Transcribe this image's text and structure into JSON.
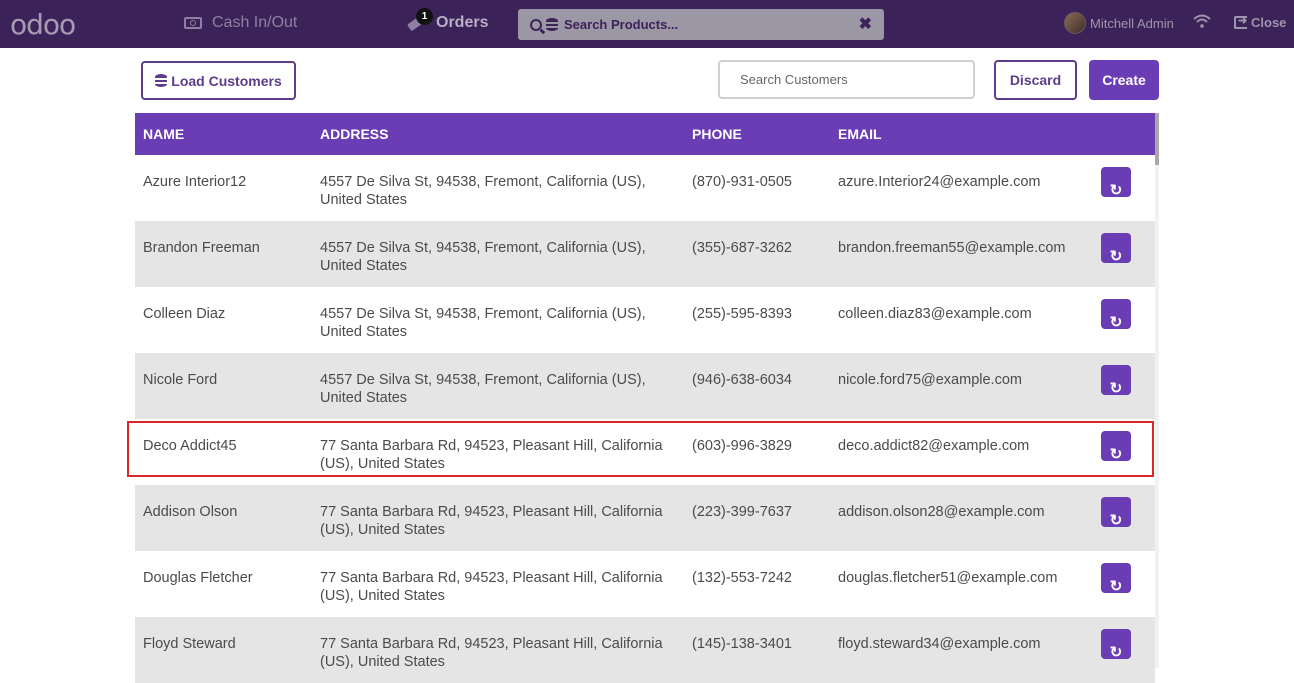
{
  "topbar": {
    "logo": "odoo",
    "cash_label": "Cash In/Out",
    "orders_label": "Orders",
    "orders_count": "1",
    "product_search_placeholder": "Search Products...",
    "clear_symbol": "✖",
    "user_name": "Mitchell Admin",
    "close_label": "Close",
    "icons": [
      "cash-icon",
      "tag-icon",
      "search-icon",
      "database-icon",
      "wifi-icon",
      "sign-out-icon"
    ]
  },
  "controls": {
    "load_customers_label": "Load Customers",
    "search_customers_placeholder": "Search Customers",
    "discard_label": "Discard",
    "create_label": "Create"
  },
  "table": {
    "headers": [
      "NAME",
      "ADDRESS",
      "PHONE",
      "EMAIL"
    ],
    "action_icon": "↻",
    "rows": [
      {
        "name": "Azure Interior12",
        "address": "4557 De Silva St, 94538, Fremont, California (US), United States",
        "phone": "(870)-931-0505",
        "email": "azure.Interior24@example.com"
      },
      {
        "name": "Brandon Freeman",
        "address": "4557 De Silva St, 94538, Fremont, California (US), United States",
        "phone": "(355)-687-3262",
        "email": "brandon.freeman55@example.com"
      },
      {
        "name": "Colleen Diaz",
        "address": "4557 De Silva St, 94538, Fremont, California (US), United States",
        "phone": "(255)-595-8393",
        "email": "colleen.diaz83@example.com"
      },
      {
        "name": "Nicole Ford",
        "address": "4557 De Silva St, 94538, Fremont, California (US), United States",
        "phone": "(946)-638-6034",
        "email": "nicole.ford75@example.com"
      },
      {
        "name": "Deco Addict45",
        "address": "77 Santa Barbara Rd, 94523, Pleasant Hill, California (US), United States",
        "phone": "(603)-996-3829",
        "email": "deco.addict82@example.com"
      },
      {
        "name": "Addison Olson",
        "address": "77 Santa Barbara Rd, 94523, Pleasant Hill, California (US), United States",
        "phone": "(223)-399-7637",
        "email": "addison.olson28@example.com"
      },
      {
        "name": "Douglas Fletcher",
        "address": "77 Santa Barbara Rd, 94523, Pleasant Hill, California (US), United States",
        "phone": "(132)-553-7242",
        "email": "douglas.fletcher51@example.com"
      },
      {
        "name": "Floyd Steward",
        "address": "77 Santa Barbara Rd, 94523, Pleasant Hill, California (US), United States",
        "phone": "(145)-138-3401",
        "email": "floyd.steward34@example.com"
      }
    ]
  },
  "colors": {
    "topbar": "#3b2258",
    "accent": "#6b3db5",
    "highlight": "#d9262b"
  }
}
